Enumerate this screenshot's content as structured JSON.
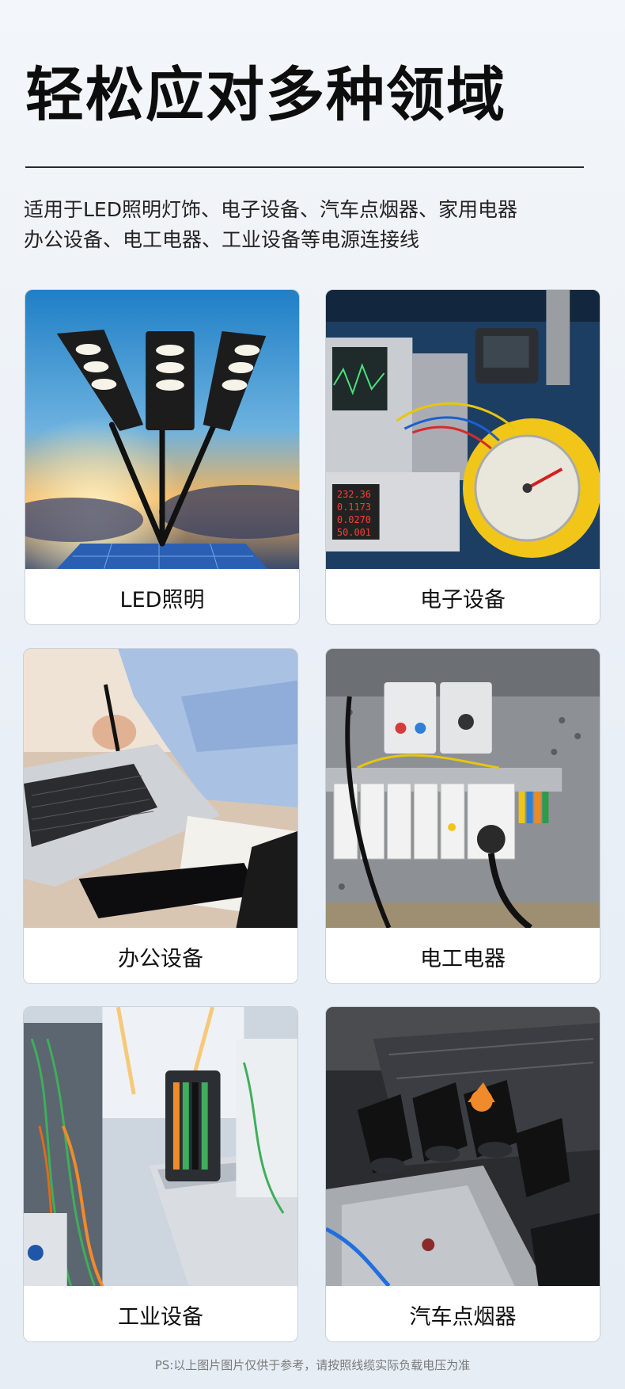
{
  "header": {
    "title": "轻松应对多种领域",
    "description_lines": [
      "适用于LED照明灯饰、电子设备、汽车点烟器、家用电器",
      "办公设备、电工电器、工业设备等电源连接线"
    ]
  },
  "cards": [
    {
      "label": "LED照明",
      "image": "solar-street-lights-photo"
    },
    {
      "label": "电子设备",
      "image": "lab-instruments-photo"
    },
    {
      "label": "办公设备",
      "image": "laptop-desk-photo"
    },
    {
      "label": "电工电器",
      "image": "electrical-panel-photo"
    },
    {
      "label": "工业设备",
      "image": "industrial-machinery-photo"
    },
    {
      "label": "汽车点烟器",
      "image": "car-engine-photo"
    }
  ],
  "footer": {
    "note": "PS:以上图片图片仅供于参考，请按照线缆实际负载电压为准"
  }
}
